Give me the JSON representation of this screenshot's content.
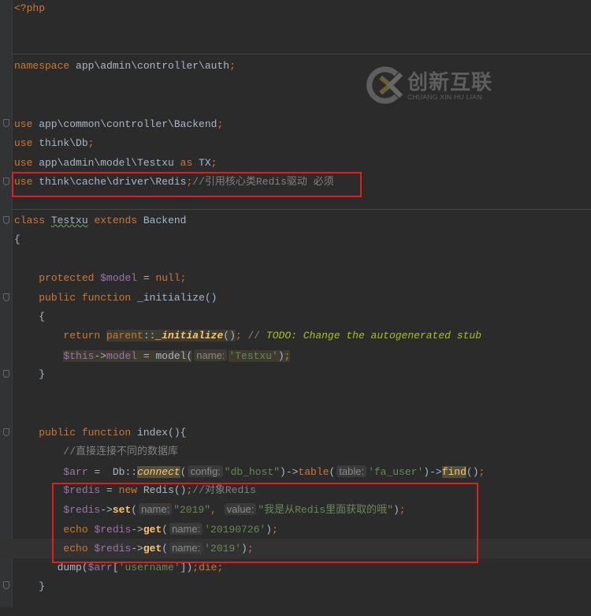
{
  "watermark": {
    "brand_cn": "创新互联",
    "brand_en": "CHUANG XIN HU LIAN"
  },
  "colors": {
    "keyword": "#cc7832",
    "text": "#a9b7c6",
    "variable": "#9876aa",
    "string": "#6a8759",
    "comment": "#808080",
    "todo": "#a8c023",
    "function": "#ffc66d",
    "highlight_box": "#e0201c"
  },
  "code": {
    "current_line": 28,
    "lines": [
      [
        [
          "k",
          "<?php"
        ]
      ],
      [],
      [],
      [
        [
          "k",
          "namespace"
        ],
        [
          "t",
          " app\\admin\\controller\\auth"
        ],
        [
          "k",
          ";"
        ]
      ],
      [],
      [],
      [
        [
          "k",
          "use"
        ],
        [
          "t",
          " app\\common\\controller\\Backend"
        ],
        [
          "k",
          ";"
        ]
      ],
      [
        [
          "k",
          "use"
        ],
        [
          "t",
          " think\\Db"
        ],
        [
          "k",
          ";"
        ]
      ],
      [
        [
          "k",
          "use"
        ],
        [
          "t",
          " app\\admin\\model\\Testxu "
        ],
        [
          "k",
          "as"
        ],
        [
          "t",
          " TX"
        ],
        [
          "k",
          ";"
        ]
      ],
      [
        [
          "k",
          "use"
        ],
        [
          "t",
          " think\\cache\\driver\\Redis"
        ],
        [
          "k",
          ";"
        ],
        [
          "c",
          "//引用核心类Redis驱动 必须"
        ]
      ],
      [],
      [
        [
          "k",
          "class"
        ],
        [
          "t",
          " "
        ],
        [
          "u",
          "Testxu"
        ],
        [
          "t",
          " "
        ],
        [
          "k",
          "extends"
        ],
        [
          "t",
          " Backend"
        ]
      ],
      [
        [
          "t",
          "{"
        ]
      ],
      [],
      [
        [
          "t",
          "    "
        ],
        [
          "k",
          "protected"
        ],
        [
          "v",
          " $model"
        ],
        [
          "t",
          " = "
        ],
        [
          "k",
          "null;"
        ]
      ],
      [
        [
          "t",
          "    "
        ],
        [
          "k",
          "public function"
        ],
        [
          "t",
          " _initialize()"
        ]
      ],
      [
        [
          "t",
          "    {"
        ]
      ],
      [
        [
          "t",
          "        "
        ],
        [
          "k",
          "return "
        ],
        [
          "hk",
          "parent"
        ],
        [
          "ht",
          "::"
        ],
        [
          "hfi",
          "_initialize"
        ],
        [
          "ht",
          "()"
        ],
        [
          "k",
          ";"
        ],
        [
          "c",
          " // "
        ],
        [
          "todo",
          "TODO: Change the autogenerated stub"
        ]
      ],
      [
        [
          "t",
          "        "
        ],
        [
          "hv",
          "$this"
        ],
        [
          "ht",
          "->"
        ],
        [
          "hv",
          "model"
        ],
        [
          "ht",
          " = model("
        ],
        [
          "hh",
          "name:"
        ],
        [
          "hs",
          "'Testxu'"
        ],
        [
          "ht",
          ")"
        ],
        [
          "hk",
          ";"
        ]
      ],
      [
        [
          "t",
          "    }"
        ]
      ],
      [],
      [],
      [
        [
          "t",
          "    "
        ],
        [
          "k",
          "public function "
        ],
        [
          "t",
          "index(){"
        ]
      ],
      [
        [
          "t",
          "        "
        ],
        [
          "c",
          "//直接连接不同的数据库"
        ]
      ],
      [
        [
          "t",
          "        "
        ],
        [
          "v",
          "$arr"
        ],
        [
          "t",
          " =  Db::"
        ],
        [
          "fnh",
          "connect"
        ],
        [
          "t",
          "("
        ],
        [
          "h",
          "config:"
        ],
        [
          "s",
          "\"db_host\""
        ],
        [
          "t",
          ")->"
        ],
        [
          "fk",
          "table"
        ],
        [
          "t",
          "("
        ],
        [
          "h",
          "table:"
        ],
        [
          "s",
          "'fa_user'"
        ],
        [
          "t",
          ")->"
        ],
        [
          "fnb",
          "find"
        ],
        [
          "t",
          "()"
        ],
        [
          "k",
          ";"
        ]
      ],
      [
        [
          "t",
          "        "
        ],
        [
          "v",
          "$redis"
        ],
        [
          "t",
          " = "
        ],
        [
          "k",
          "new "
        ],
        [
          "t",
          "Redis()"
        ],
        [
          "k",
          ";"
        ],
        [
          "c",
          "//对象Redis"
        ]
      ],
      [
        [
          "t",
          "        "
        ],
        [
          "v",
          "$redis"
        ],
        [
          "t",
          "->"
        ],
        [
          "fn",
          "set"
        ],
        [
          "t",
          "("
        ],
        [
          "h",
          "name:"
        ],
        [
          "s",
          "\"2019\""
        ],
        [
          "k",
          ", "
        ],
        [
          "h",
          "value:"
        ],
        [
          "s",
          "\"我是从Redis里面获取的哦\""
        ],
        [
          "t",
          ")"
        ],
        [
          "k",
          ";"
        ]
      ],
      [
        [
          "t",
          "        "
        ],
        [
          "k",
          "echo "
        ],
        [
          "v",
          "$redis"
        ],
        [
          "t",
          "->"
        ],
        [
          "fn",
          "get"
        ],
        [
          "t",
          "("
        ],
        [
          "h",
          "name:"
        ],
        [
          "s",
          "'20190726'"
        ],
        [
          "t",
          ")"
        ],
        [
          "k",
          ";"
        ]
      ],
      [
        [
          "t",
          "        "
        ],
        [
          "k",
          "echo "
        ],
        [
          "v",
          "$redis"
        ],
        [
          "t",
          "->"
        ],
        [
          "fn",
          "get"
        ],
        [
          "t",
          "("
        ],
        [
          "h",
          "name:"
        ],
        [
          "s",
          "'2019'"
        ],
        [
          "t",
          ")"
        ],
        [
          "k",
          ";"
        ]
      ],
      [
        [
          "t",
          "       dump("
        ],
        [
          "v",
          "$arr"
        ],
        [
          "t",
          "["
        ],
        [
          "s",
          "'username'"
        ],
        [
          "t",
          "])"
        ],
        [
          "k",
          ";die;"
        ]
      ],
      [
        [
          "t",
          "    }"
        ]
      ],
      []
    ]
  }
}
